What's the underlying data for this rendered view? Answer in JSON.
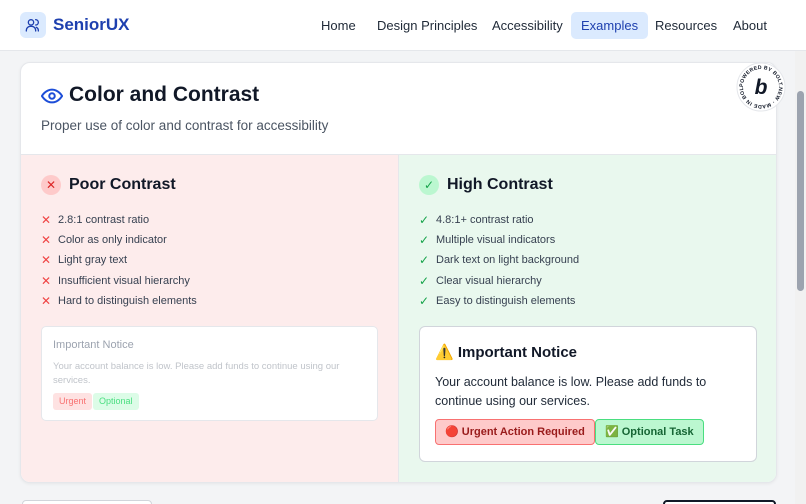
{
  "header": {
    "brand": "SeniorUX",
    "nav": [
      {
        "label": "Home",
        "active": false
      },
      {
        "label": "Design Principles",
        "active": false
      },
      {
        "label": "Accessibility",
        "active": false
      },
      {
        "label": "Examples",
        "active": true
      },
      {
        "label": "Resources",
        "active": false
      },
      {
        "label": "About",
        "active": false
      }
    ]
  },
  "card": {
    "icon": "eye-icon",
    "title": "Color and Contrast",
    "subtitle": "Proper use of color and contrast for accessibility",
    "poor": {
      "title": "Poor Contrast",
      "items": [
        "2.8:1 contrast ratio",
        "Color as only indicator",
        "Light gray text",
        "Insufficient visual hierarchy",
        "Hard to distinguish elements"
      ],
      "notice": {
        "title": "Important Notice",
        "body": "Your account balance is low. Please add funds to continue using our services.",
        "badge_urgent": "Urgent",
        "badge_optional": "Optional"
      }
    },
    "high": {
      "title": "High Contrast",
      "items": [
        "4.8:1+ contrast ratio",
        "Multiple visual indicators",
        "Dark text on light background",
        "Clear visual hierarchy",
        "Easy to distinguish elements"
      ],
      "notice": {
        "title": "⚠️ Important Notice",
        "body": "Your account balance is low. Please add funds to continue using our services.",
        "badge_urgent": "🔴 Urgent Action Required",
        "badge_optional": "✅ Optional Task"
      }
    }
  },
  "bolt_badge": {
    "ring_text": "POWERED BY BOLT.NEW · MADE IN BOLT.NEW ·",
    "letter": "b"
  },
  "colors": {
    "brand": "#1e40af",
    "poor_bg": "#fdecec",
    "high_bg": "#e9f8ee"
  }
}
